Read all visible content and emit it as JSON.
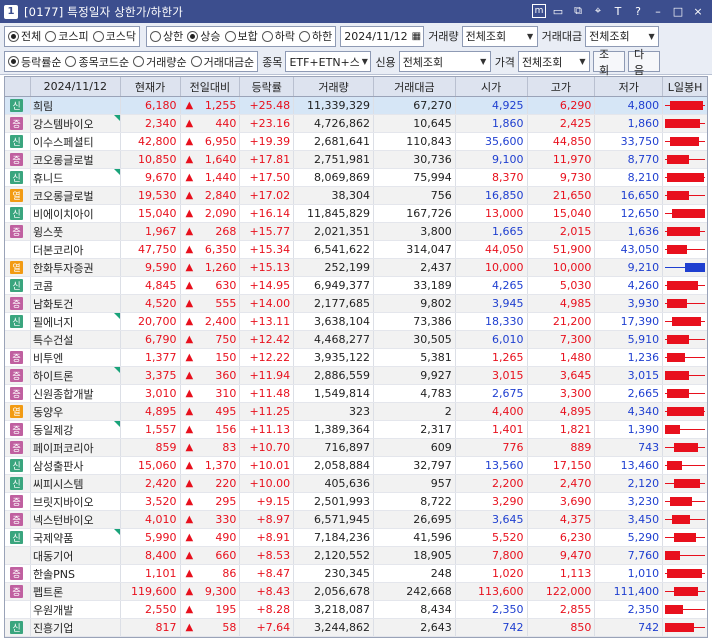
{
  "titlebar": {
    "screen_no": "1",
    "title": "[0177] 특정일자 상한가/하한가",
    "tools": [
      "m",
      "▭",
      "⧉",
      "⌖",
      "T",
      "?",
      "–",
      "□",
      "×"
    ]
  },
  "filters_row1": {
    "market": [
      {
        "label": "전체",
        "selected": true
      },
      {
        "label": "코스피",
        "selected": false
      },
      {
        "label": "코스닥",
        "selected": false
      }
    ],
    "range": [
      {
        "label": "상한",
        "selected": false
      },
      {
        "label": "상승",
        "selected": true
      },
      {
        "label": "보합",
        "selected": false
      },
      {
        "label": "하락",
        "selected": false
      },
      {
        "label": "하한",
        "selected": false
      }
    ],
    "date": "2024/11/12",
    "volume_label": "거래량",
    "volume_value": "전체조회",
    "amount_label": "거래대금",
    "amount_value": "전체조회"
  },
  "filters_row2": {
    "sort": [
      {
        "label": "등락률순",
        "selected": true
      },
      {
        "label": "종목코드순",
        "selected": false
      },
      {
        "label": "거래량순",
        "selected": false
      },
      {
        "label": "거래대금순",
        "selected": false
      }
    ],
    "item_label": "종목",
    "item_value": "ETF+ETN+스팩",
    "credit_label": "신용",
    "credit_value": "전체조회",
    "price_label": "가격",
    "price_value": "전체조회",
    "search_btn": "조회",
    "next_btn": "다음"
  },
  "table": {
    "headers": [
      "",
      "2024/11/12",
      "현재가",
      "전일대비",
      "등락률",
      "거래량",
      "거래대금",
      "시가",
      "고가",
      "저가",
      "L일봉H"
    ],
    "rows": [
      {
        "badge": "신",
        "name": "희림",
        "price": "6,180",
        "diff": "1,255",
        "rate": "+25.48",
        "vol": "11,339,329",
        "amt": "67,270",
        "open": "4,925",
        "high": "6,290",
        "low": "4,800",
        "oc": "blue",
        "hc": "red",
        "lc": "blue",
        "flag": false,
        "c": {
          "lo": 0.05,
          "hi": 0.95,
          "bs": 0.15,
          "be": 0.9,
          "col": "red"
        }
      },
      {
        "badge": "증",
        "name": "강스템바이오",
        "price": "2,340",
        "diff": "440",
        "rate": "+23.16",
        "vol": "4,726,862",
        "amt": "10,645",
        "open": "1,860",
        "high": "2,425",
        "low": "1,860",
        "oc": "blue",
        "hc": "red",
        "lc": "blue",
        "flag": true,
        "c": {
          "lo": 0.05,
          "hi": 0.95,
          "bs": 0.05,
          "be": 0.85,
          "col": "red"
        }
      },
      {
        "badge": "신",
        "name": "이수스페셜티",
        "price": "42,800",
        "diff": "6,950",
        "rate": "+19.39",
        "vol": "2,681,641",
        "amt": "110,843",
        "open": "35,600",
        "high": "44,850",
        "low": "33,750",
        "oc": "blue",
        "hc": "red",
        "lc": "blue",
        "flag": false,
        "c": {
          "lo": 0.05,
          "hi": 0.95,
          "bs": 0.15,
          "be": 0.8,
          "col": "red"
        }
      },
      {
        "badge": "증",
        "name": "코오롱글로벌",
        "price": "10,850",
        "diff": "1,640",
        "rate": "+17.81",
        "vol": "2,751,981",
        "amt": "30,736",
        "open": "9,100",
        "high": "11,970",
        "low": "8,770",
        "oc": "blue",
        "hc": "red",
        "lc": "blue",
        "flag": false,
        "c": {
          "lo": 0.05,
          "hi": 0.95,
          "bs": 0.1,
          "be": 0.6,
          "col": "red"
        }
      },
      {
        "badge": "신",
        "name": "휴니드",
        "price": "9,670",
        "diff": "1,440",
        "rate": "+17.50",
        "vol": "8,069,869",
        "amt": "75,994",
        "open": "8,370",
        "high": "9,730",
        "low": "8,210",
        "oc": "red",
        "hc": "red",
        "lc": "blue",
        "flag": true,
        "c": {
          "lo": 0.05,
          "hi": 0.95,
          "bs": 0.1,
          "be": 0.95,
          "col": "red"
        }
      },
      {
        "badge": "열",
        "name": "코오롱글로벌",
        "price": "19,530",
        "diff": "2,840",
        "rate": "+17.02",
        "vol": "38,304",
        "amt": "756",
        "open": "16,850",
        "high": "21,650",
        "low": "16,650",
        "oc": "blue",
        "hc": "red",
        "lc": "blue",
        "flag": false,
        "c": {
          "lo": 0.05,
          "hi": 0.95,
          "bs": 0.1,
          "be": 0.6,
          "col": "red"
        }
      },
      {
        "badge": "신",
        "name": "비에이치아이",
        "price": "15,040",
        "diff": "2,090",
        "rate": "+16.14",
        "vol": "11,845,829",
        "amt": "167,726",
        "open": "13,000",
        "high": "15,040",
        "low": "12,650",
        "oc": "red",
        "hc": "red",
        "lc": "blue",
        "flag": false,
        "c": {
          "lo": 0.05,
          "hi": 0.95,
          "bs": 0.2,
          "be": 0.95,
          "col": "red"
        }
      },
      {
        "badge": "증",
        "name": "윙스풋",
        "price": "1,967",
        "diff": "268",
        "rate": "+15.77",
        "vol": "2,021,351",
        "amt": "3,800",
        "open": "1,665",
        "high": "2,015",
        "low": "1,636",
        "oc": "blue",
        "hc": "red",
        "lc": "blue",
        "flag": false,
        "c": {
          "lo": 0.05,
          "hi": 0.95,
          "bs": 0.1,
          "be": 0.85,
          "col": "red"
        }
      },
      {
        "badge": "",
        "name": "더본코리아",
        "price": "47,750",
        "diff": "6,350",
        "rate": "+15.34",
        "vol": "6,541,622",
        "amt": "314,047",
        "open": "44,050",
        "high": "51,900",
        "low": "43,050",
        "oc": "red",
        "hc": "red",
        "lc": "blue",
        "flag": false,
        "c": {
          "lo": 0.05,
          "hi": 0.95,
          "bs": 0.1,
          "be": 0.55,
          "col": "red"
        }
      },
      {
        "badge": "열",
        "name": "한화투자증권",
        "price": "9,590",
        "diff": "1,260",
        "rate": "+15.13",
        "vol": "252,199",
        "amt": "2,437",
        "open": "10,000",
        "high": "10,000",
        "low": "9,210",
        "oc": "red",
        "hc": "red",
        "lc": "blue",
        "flag": false,
        "c": {
          "lo": 0.05,
          "hi": 0.95,
          "bs": 0.5,
          "be": 0.95,
          "col": "blue"
        }
      },
      {
        "badge": "신",
        "name": "코콤",
        "price": "4,845",
        "diff": "630",
        "rate": "+14.95",
        "vol": "6,949,377",
        "amt": "33,189",
        "open": "4,265",
        "high": "5,030",
        "low": "4,260",
        "oc": "blue",
        "hc": "red",
        "lc": "blue",
        "flag": false,
        "c": {
          "lo": 0.05,
          "hi": 0.95,
          "bs": 0.1,
          "be": 0.8,
          "col": "red"
        }
      },
      {
        "badge": "증",
        "name": "남화토건",
        "price": "4,520",
        "diff": "555",
        "rate": "+14.00",
        "vol": "2,177,685",
        "amt": "9,802",
        "open": "3,945",
        "high": "4,985",
        "low": "3,930",
        "oc": "blue",
        "hc": "red",
        "lc": "blue",
        "flag": false,
        "c": {
          "lo": 0.05,
          "hi": 0.95,
          "bs": 0.1,
          "be": 0.55,
          "col": "red"
        }
      },
      {
        "badge": "신",
        "name": "필에너지",
        "price": "20,700",
        "diff": "2,400",
        "rate": "+13.11",
        "vol": "3,638,104",
        "amt": "73,386",
        "open": "18,330",
        "high": "21,200",
        "low": "17,390",
        "oc": "blue",
        "hc": "red",
        "lc": "blue",
        "flag": true,
        "c": {
          "lo": 0.05,
          "hi": 0.95,
          "bs": 0.2,
          "be": 0.85,
          "col": "red"
        }
      },
      {
        "badge": "",
        "name": "특수건설",
        "price": "6,790",
        "diff": "750",
        "rate": "+12.42",
        "vol": "4,468,277",
        "amt": "30,505",
        "open": "6,010",
        "high": "7,300",
        "low": "5,910",
        "oc": "blue",
        "hc": "red",
        "lc": "blue",
        "flag": false,
        "c": {
          "lo": 0.05,
          "hi": 0.95,
          "bs": 0.1,
          "be": 0.6,
          "col": "red"
        }
      },
      {
        "badge": "증",
        "name": "비투엔",
        "price": "1,377",
        "diff": "150",
        "rate": "+12.22",
        "vol": "3,935,122",
        "amt": "5,381",
        "open": "1,265",
        "high": "1,480",
        "low": "1,236",
        "oc": "red",
        "hc": "red",
        "lc": "blue",
        "flag": false,
        "c": {
          "lo": 0.05,
          "hi": 0.95,
          "bs": 0.1,
          "be": 0.5,
          "col": "red"
        }
      },
      {
        "badge": "증",
        "name": "하이트론",
        "price": "3,375",
        "diff": "360",
        "rate": "+11.94",
        "vol": "2,886,559",
        "amt": "9,927",
        "open": "3,015",
        "high": "3,645",
        "low": "3,015",
        "oc": "red",
        "hc": "red",
        "lc": "blue",
        "flag": true,
        "c": {
          "lo": 0.05,
          "hi": 0.95,
          "bs": 0.05,
          "be": 0.6,
          "col": "red"
        }
      },
      {
        "badge": "증",
        "name": "신원종합개발",
        "price": "3,010",
        "diff": "310",
        "rate": "+11.48",
        "vol": "1,549,814",
        "amt": "4,783",
        "open": "2,675",
        "high": "3,300",
        "low": "2,665",
        "oc": "blue",
        "hc": "red",
        "lc": "blue",
        "flag": false,
        "c": {
          "lo": 0.05,
          "hi": 0.95,
          "bs": 0.1,
          "be": 0.6,
          "col": "red"
        }
      },
      {
        "badge": "열",
        "name": "동양우",
        "price": "4,895",
        "diff": "495",
        "rate": "+11.25",
        "vol": "323",
        "amt": "2",
        "open": "4,400",
        "high": "4,895",
        "low": "4,340",
        "oc": "red",
        "hc": "red",
        "lc": "blue",
        "flag": false,
        "c": {
          "lo": 0.05,
          "hi": 0.95,
          "bs": 0.1,
          "be": 0.95,
          "col": "red"
        }
      },
      {
        "badge": "증",
        "name": "동일제강",
        "price": "1,557",
        "diff": "156",
        "rate": "+11.13",
        "vol": "1,389,364",
        "amt": "2,317",
        "open": "1,401",
        "high": "1,821",
        "low": "1,390",
        "oc": "red",
        "hc": "red",
        "lc": "blue",
        "flag": true,
        "c": {
          "lo": 0.05,
          "hi": 0.95,
          "bs": 0.05,
          "be": 0.4,
          "col": "red"
        }
      },
      {
        "badge": "증",
        "name": "페이퍼코리아",
        "price": "859",
        "diff": "83",
        "rate": "+10.70",
        "vol": "716,897",
        "amt": "609",
        "open": "776",
        "high": "889",
        "low": "743",
        "oc": "red",
        "hc": "red",
        "lc": "blue",
        "flag": false,
        "c": {
          "lo": 0.05,
          "hi": 0.95,
          "bs": 0.25,
          "be": 0.8,
          "col": "red"
        }
      },
      {
        "badge": "신",
        "name": "삼성출판사",
        "price": "15,060",
        "diff": "1,370",
        "rate": "+10.01",
        "vol": "2,058,884",
        "amt": "32,797",
        "open": "13,560",
        "high": "17,150",
        "low": "13,460",
        "oc": "blue",
        "hc": "red",
        "lc": "blue",
        "flag": false,
        "c": {
          "lo": 0.05,
          "hi": 0.95,
          "bs": 0.1,
          "be": 0.45,
          "col": "red"
        }
      },
      {
        "badge": "신",
        "name": "씨피시스템",
        "price": "2,420",
        "diff": "220",
        "rate": "+10.00",
        "vol": "405,636",
        "amt": "957",
        "open": "2,200",
        "high": "2,470",
        "low": "2,120",
        "oc": "red",
        "hc": "red",
        "lc": "blue",
        "flag": false,
        "c": {
          "lo": 0.05,
          "hi": 0.95,
          "bs": 0.25,
          "be": 0.85,
          "col": "red"
        }
      },
      {
        "badge": "증",
        "name": "브릿지바이오",
        "price": "3,520",
        "diff": "295",
        "rate": "+9.15",
        "vol": "2,501,993",
        "amt": "8,722",
        "open": "3,290",
        "high": "3,690",
        "low": "3,230",
        "oc": "red",
        "hc": "red",
        "lc": "blue",
        "flag": false,
        "c": {
          "lo": 0.05,
          "hi": 0.95,
          "bs": 0.15,
          "be": 0.65,
          "col": "red"
        }
      },
      {
        "badge": "증",
        "name": "넥스턴바이오",
        "price": "4,010",
        "diff": "330",
        "rate": "+8.97",
        "vol": "6,571,945",
        "amt": "26,695",
        "open": "3,645",
        "high": "4,375",
        "low": "3,450",
        "oc": "blue",
        "hc": "red",
        "lc": "blue",
        "flag": false,
        "c": {
          "lo": 0.05,
          "hi": 0.95,
          "bs": 0.2,
          "be": 0.6,
          "col": "red"
        }
      },
      {
        "badge": "신",
        "name": "국제약품",
        "price": "5,990",
        "diff": "490",
        "rate": "+8.91",
        "vol": "7,184,236",
        "amt": "41,596",
        "open": "5,520",
        "high": "6,230",
        "low": "5,290",
        "oc": "red",
        "hc": "red",
        "lc": "blue",
        "flag": true,
        "c": {
          "lo": 0.05,
          "hi": 0.95,
          "bs": 0.25,
          "be": 0.75,
          "col": "red"
        }
      },
      {
        "badge": "",
        "name": "대동기어",
        "price": "8,400",
        "diff": "660",
        "rate": "+8.53",
        "vol": "2,120,552",
        "amt": "18,905",
        "open": "7,800",
        "high": "9,470",
        "low": "7,760",
        "oc": "red",
        "hc": "red",
        "lc": "blue",
        "flag": false,
        "c": {
          "lo": 0.05,
          "hi": 0.95,
          "bs": 0.05,
          "be": 0.4,
          "col": "red"
        }
      },
      {
        "badge": "증",
        "name": "한솔PNS",
        "price": "1,101",
        "diff": "86",
        "rate": "+8.47",
        "vol": "230,345",
        "amt": "248",
        "open": "1,020",
        "high": "1,113",
        "low": "1,010",
        "oc": "red",
        "hc": "red",
        "lc": "blue",
        "flag": false,
        "c": {
          "lo": 0.05,
          "hi": 0.95,
          "bs": 0.1,
          "be": 0.9,
          "col": "red"
        }
      },
      {
        "badge": "증",
        "name": "펩트론",
        "price": "119,600",
        "diff": "9,300",
        "rate": "+8.43",
        "vol": "2,056,678",
        "amt": "242,668",
        "open": "113,600",
        "high": "122,000",
        "low": "111,400",
        "oc": "red",
        "hc": "red",
        "lc": "blue",
        "flag": false,
        "c": {
          "lo": 0.05,
          "hi": 0.95,
          "bs": 0.25,
          "be": 0.8,
          "col": "red"
        }
      },
      {
        "badge": "",
        "name": "우원개발",
        "price": "2,550",
        "diff": "195",
        "rate": "+8.28",
        "vol": "3,218,087",
        "amt": "8,434",
        "open": "2,350",
        "high": "2,855",
        "low": "2,350",
        "oc": "blue",
        "hc": "red",
        "lc": "blue",
        "flag": false,
        "c": {
          "lo": 0.05,
          "hi": 0.95,
          "bs": 0.05,
          "be": 0.45,
          "col": "red"
        }
      },
      {
        "badge": "신",
        "name": "진흥기업",
        "price": "817",
        "diff": "58",
        "rate": "+7.64",
        "vol": "3,244,862",
        "amt": "2,643",
        "open": "742",
        "high": "850",
        "low": "742",
        "oc": "blue",
        "hc": "red",
        "lc": "blue",
        "flag": false,
        "c": {
          "lo": 0.05,
          "hi": 0.95,
          "bs": 0.05,
          "be": 0.7,
          "col": "red"
        }
      }
    ]
  },
  "colors": {
    "up": "#e8101d",
    "down": "#1f3fd0",
    "selected_row": "#d6e6f6",
    "title_bar": "#3c4e8e"
  }
}
